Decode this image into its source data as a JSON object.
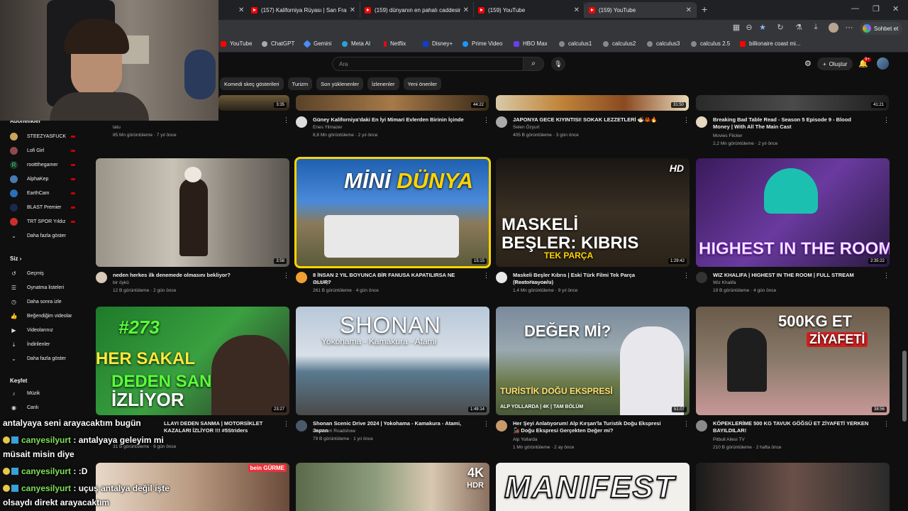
{
  "browser": {
    "tabs": [
      {
        "title": "(157) Kaliforniya Rüyası | San Franc",
        "active": false
      },
      {
        "title": "(159) dünyanın en pahalı caddesin",
        "active": false
      },
      {
        "title": "(159) YouTube",
        "active": false
      },
      {
        "title": "(159) YouTube",
        "active": true
      }
    ],
    "copilot_label": "Sohbet et",
    "bookmarks": [
      "YouTube",
      "ChatGPT",
      "Gemini",
      "Meta AI",
      "Netflix",
      "Disney+",
      "Prime Video",
      "HBO Max",
      "calculus1",
      "calculus2",
      "calculus3",
      "calculus 2.5",
      "billionaire coast mi..."
    ]
  },
  "youtube": {
    "search_placeholder": "Ara",
    "create_label": "Oluştur",
    "notif_count": "9+",
    "chips": [
      "Komedi skeç gösterileri",
      "Turizm",
      "Son yüklenenler",
      "İzlenenler",
      "Yeni öneriler"
    ]
  },
  "sidebar": {
    "subs_heading": "Abonelikler",
    "subs": [
      "STEEZYASFUCK",
      "Lofi Girl",
      "roottthegamer",
      "AlphaKep",
      "EarthCam",
      "BLAST Premier",
      "TRT SPOR Yıldız",
      "Daha fazla göster"
    ],
    "you_heading": "Siz",
    "you_items": [
      "Geçmiş",
      "Oynatma listeleri",
      "Daha sonra izle",
      "Beğendiğim videolar",
      "Videolarınız",
      "İndirilenler",
      "Daha fazla göster"
    ],
    "explore_heading": "Keşfet",
    "explore_items": [
      "Müzik",
      "Canlı"
    ]
  },
  "row0": [
    {
      "title": "",
      "channel": "tatu",
      "meta": "85 Mn görüntüleme · 7 yıl önce",
      "duration": "3:35"
    },
    {
      "title": "Güney Kaliforniya'daki En İyi Mimari Evlerden Birinin İçinde",
      "channel": "Enes Yilmazer",
      "meta": "8,8 Mn görüntüleme · 2 yıl önce",
      "duration": "44:22"
    },
    {
      "title": "JAPONYA GECE KIYINTISI! SOKAK LEZZETLERİ 🍜🦀🔥",
      "channel": "Selen Özyurt",
      "meta": "405 B görüntüleme · 3 gün önce",
      "duration": "31:50"
    },
    {
      "title": "Breaking Bad Table Read - Season 5 Episode 9 - Blood Money | With All The Main Cast",
      "channel": "Movies Flicker",
      "meta": "2,2 Mn görüntüleme · 2 yıl önce",
      "duration": "41:21"
    }
  ],
  "row1": [
    {
      "title": "neden herkes ilk denemede olmasını bekliyor?",
      "channel": "bir öykü",
      "meta": "12 B görüntüleme · 2 gün önce",
      "duration": "3:58",
      "overlay": ""
    },
    {
      "title": "8 İNSAN 2 YIL BOYUNCA BİR FANUSA KAPATILIRSA NE OLUR?",
      "channel": "Bentropi",
      "meta": "261 B görüntüleme · 4 gün önce",
      "duration": "15:15",
      "overlay1": "MİNİ",
      "overlay2": "DÜNYA"
    },
    {
      "title": "Maskeli Beşler Kıbrıs | Eski Türk Filmi Tek Parça (Restorasyonlu)",
      "channel": "Fanatik Film - Yerli",
      "meta": "1,4 Mn görüntüleme · 9 yıl önce",
      "duration": "1:29:42",
      "overlay1": "MASKELİ",
      "overlay2": "BEŞLER: KIBRIS",
      "overlay3": "TEK PARÇA",
      "hd": "HD"
    },
    {
      "title": "WIZ KHALIFA | HIGHEST IN THE ROOM | FULL STREAM",
      "channel": "Wiz Khalifa",
      "meta": "19 B görüntüleme · 4 gün önce",
      "duration": "2:35:22",
      "overlay1": "HIGHEST IN THE ROOM"
    }
  ],
  "row2": [
    {
      "title": "LLAYI DEDEN SANMA | MOTORSİKLET KAZALARI İZLİYOR !!! #5Striders",
      "channel": "",
      "meta": "31 B görüntüleme · 6 gün önce",
      "duration": "23:27",
      "overlay1": "#273",
      "overlay2": "HER SAKAL",
      "overlay3": "DEDEN SAN",
      "overlay4": "İZLİYOR"
    },
    {
      "title": "Shonan Scenic Drive 2024 | Yokohama - Kamakura - Atami, Japan",
      "channel": "Dashcam Roadshow",
      "meta": "79 B görüntüleme · 1 yıl önce",
      "duration": "1:49:14",
      "overlay1": "SHONAN",
      "overlay2": "Yokohama - Kamakura - Atami"
    },
    {
      "title": "Her Şeyi Anlatıyorum! Alp Kırşan'la Turistik Doğu Ekspresi 🚂 Doğu Ekspresi Gerçekten Değer mi?",
      "channel": "Alp Yollarda",
      "meta": "1 Mn görüntüleme · 2 ay önce",
      "duration": "51:07",
      "overlay1": "DEĞER Mİ?",
      "overlay2": "TURİSTİK DOĞU EKSPRESİ",
      "overlay3": "ALP YOLLARDA  |  4K  |  TAM BÖLÜM"
    },
    {
      "title": "KÖPEKLERİME 500 KG TAVUK GÖĞSÜ ET ZİYAFETİ YERKEN BAYILDILAR!",
      "channel": "Pitbull Ailesi TV",
      "meta": "210 B görüntüleme · 2 hafta önce",
      "duration": "38:56",
      "overlay1": "500KG ET",
      "overlay2": "ZİYAFETİ"
    }
  ],
  "row3": [
    {
      "overlay": "bein GÜRME"
    },
    {
      "overlay1": "4K",
      "overlay2": "HDR"
    },
    {
      "overlay": "MANIFEST"
    },
    {
      "overlay": ""
    }
  ],
  "chat": [
    {
      "user": "",
      "text": "antalyaya seni arayacaktım bugün"
    },
    {
      "user": "canyesilyurt",
      "text": ": antalyaya geleyim mi"
    },
    {
      "user": "",
      "text": "müsait misin diye"
    },
    {
      "user": "canyesilyurt",
      "text": ": :D"
    },
    {
      "user": "canyesilyurt",
      "text": ": uçuş antalya değil işte"
    },
    {
      "user": "",
      "text": "olsaydı direkt arayacaktım"
    }
  ]
}
